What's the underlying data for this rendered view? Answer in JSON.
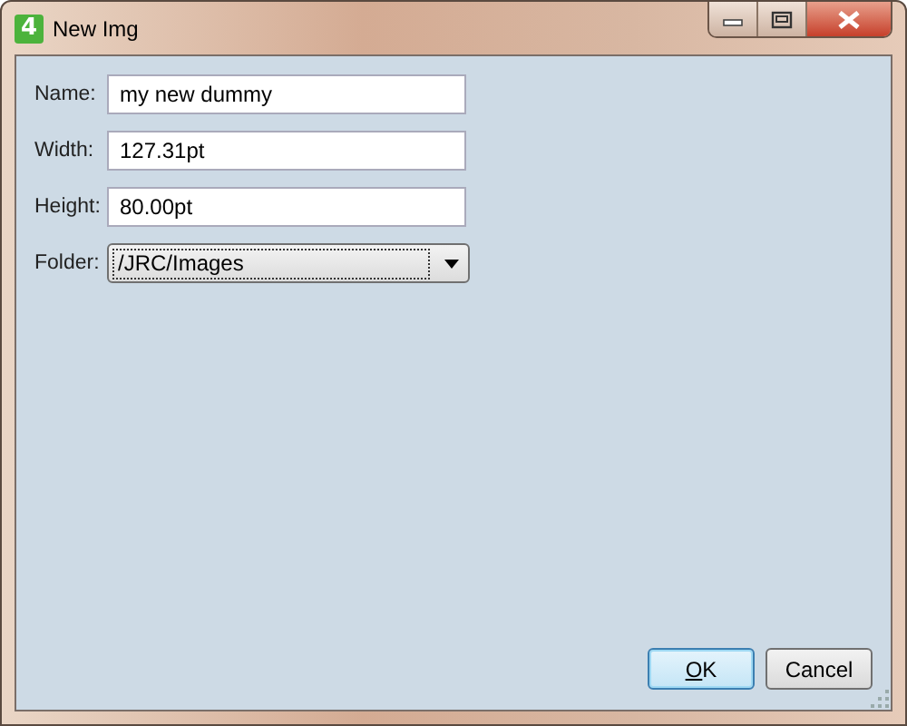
{
  "window": {
    "title": "New Img",
    "app_icon": "4"
  },
  "fields": [
    {
      "label": "Name:",
      "value": "my new dummy",
      "kind": "text"
    },
    {
      "label": "Width:",
      "value": "127.31pt",
      "kind": "text"
    },
    {
      "label": "Height:",
      "value": "80.00pt",
      "kind": "text"
    },
    {
      "label": "Folder:",
      "value": "/JRC/Images",
      "kind": "dropdown"
    }
  ],
  "buttons": [
    {
      "label": "OK",
      "default": true
    },
    {
      "label": "Cancel",
      "default": false
    }
  ]
}
